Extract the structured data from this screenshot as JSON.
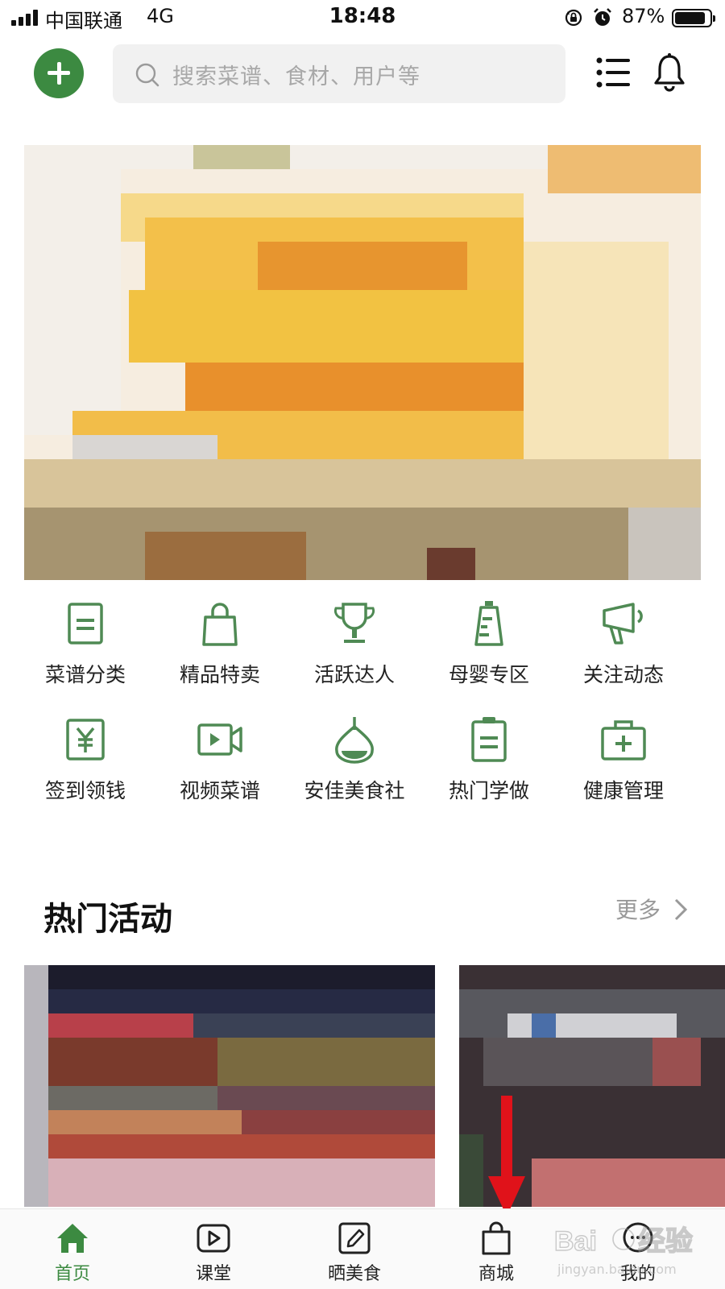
{
  "status_bar": {
    "carrier": "中国联通",
    "network": "4G",
    "time": "18:48",
    "battery_percent": "87%",
    "battery_level": 0.87
  },
  "header": {
    "search_placeholder": "搜索菜谱、食材、用户等",
    "icons": [
      "add-icon",
      "search-icon",
      "list-icon",
      "bell-icon"
    ]
  },
  "features": {
    "items": [
      {
        "label": "菜谱分类",
        "icon": "recipe-category-icon"
      },
      {
        "label": "精品特卖",
        "icon": "shopping-bag-icon"
      },
      {
        "label": "活跃达人",
        "icon": "trophy-icon"
      },
      {
        "label": "母婴专区",
        "icon": "baby-bottle-icon"
      },
      {
        "label": "关注动态",
        "icon": "megaphone-icon"
      },
      {
        "label": "签到领钱",
        "icon": "yen-icon"
      },
      {
        "label": "视频菜谱",
        "icon": "video-camera-icon"
      },
      {
        "label": "安佳美食社",
        "icon": "cream-drop-icon"
      },
      {
        "label": "热门学做",
        "icon": "clipboard-icon"
      },
      {
        "label": "健康管理",
        "icon": "medical-kit-icon"
      }
    ]
  },
  "hot_activities": {
    "title": "热门活动",
    "more_label": "更多"
  },
  "tab_bar": {
    "active": 0,
    "tabs": [
      {
        "label": "首页",
        "icon": "home-icon"
      },
      {
        "label": "课堂",
        "icon": "play-icon"
      },
      {
        "label": "晒美食",
        "icon": "edit-icon"
      },
      {
        "label": "商城",
        "icon": "shopping-bag-icon"
      },
      {
        "label": "我的",
        "icon": "chat-icon"
      }
    ]
  },
  "watermark": {
    "text": "jingyan.baidu.com"
  },
  "colors": {
    "accent": "#3c8a41",
    "icon_green": "#4f8a54",
    "annotation_red": "#e0121a"
  }
}
